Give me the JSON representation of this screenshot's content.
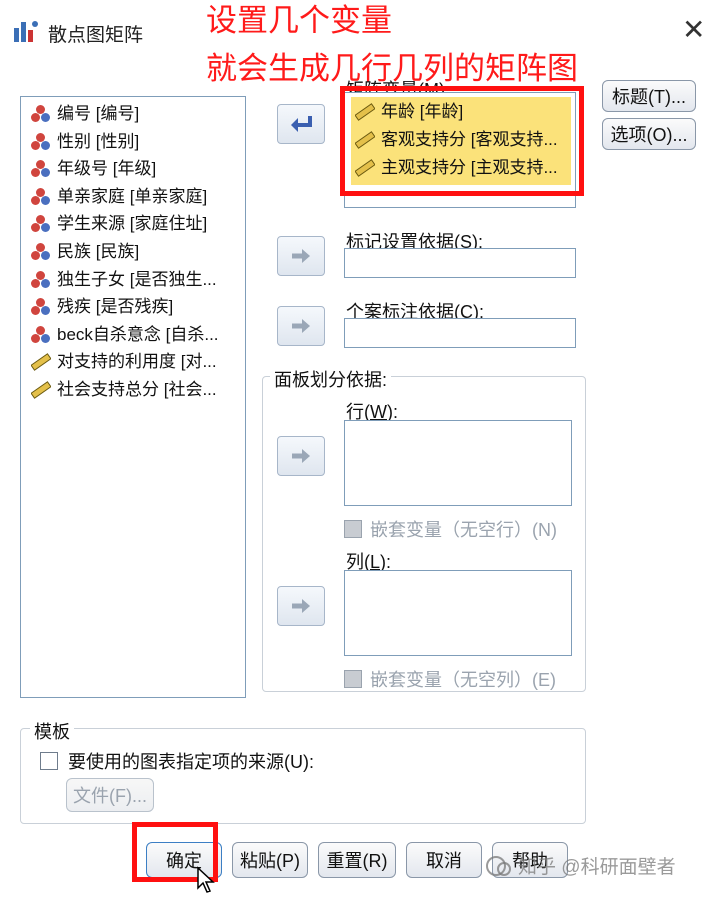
{
  "window": {
    "title": "散点图矩阵",
    "close_glyph": "✕"
  },
  "annotation": {
    "line1": "设置几个变量",
    "line2": "就会生成几行几列的矩阵图",
    "color": "#ff1a1a"
  },
  "source_list": {
    "items": [
      {
        "label": "编号 [编号]",
        "icon": "nominal-icon"
      },
      {
        "label": "性别 [性别]",
        "icon": "nominal-icon"
      },
      {
        "label": "年级号 [年级]",
        "icon": "nominal-icon"
      },
      {
        "label": "单亲家庭 [单亲家庭]",
        "icon": "nominal-icon"
      },
      {
        "label": "学生来源 [家庭住址]",
        "icon": "nominal-icon"
      },
      {
        "label": "民族 [民族]",
        "icon": "nominal-icon"
      },
      {
        "label": "独生子女 [是否独生...",
        "icon": "nominal-icon"
      },
      {
        "label": "残疾 [是否残疾]",
        "icon": "nominal-icon"
      },
      {
        "label": "beck自杀意念 [自杀...",
        "icon": "nominal-icon"
      },
      {
        "label": "对支持的利用度 [对...",
        "icon": "scale-icon"
      },
      {
        "label": "社会支持总分 [社会...",
        "icon": "scale-icon"
      }
    ]
  },
  "matrix": {
    "label": "矩阵变量(M):",
    "items": [
      "年龄 [年龄]",
      "客观支持分 [客观支持...",
      "主观支持分 [主观支持..."
    ],
    "highlight_color": "#fbe27a"
  },
  "markers": {
    "label_pre": "标记设置依据(",
    "mnemonic": "S",
    "label_post": "):"
  },
  "case_labels": {
    "label_pre": "个案标注依据(",
    "mnemonic": "C",
    "label_post": "):"
  },
  "panel": {
    "title": "面板划分依据:",
    "rows_label_pre": "行(",
    "rows_mnemonic": "W",
    "rows_label_post": "):",
    "rows_nest": "嵌套变量（无空行）(N)",
    "cols_label_pre": "列(",
    "cols_mnemonic": "L",
    "cols_label_post": "):",
    "cols_nest": "嵌套变量（无空列）(E)"
  },
  "side_buttons": {
    "titles": "标题(T)...",
    "options": "选项(O)..."
  },
  "template": {
    "title": "模板",
    "checkbox_label": "要使用的图表指定项的来源(U):",
    "file_button": "文件(F)..."
  },
  "footer": {
    "ok": "确定",
    "paste": "粘贴(P)",
    "reset": "重置(R)",
    "cancel": "取消",
    "help": "帮助"
  },
  "watermark": "知乎 @科研面壁者"
}
